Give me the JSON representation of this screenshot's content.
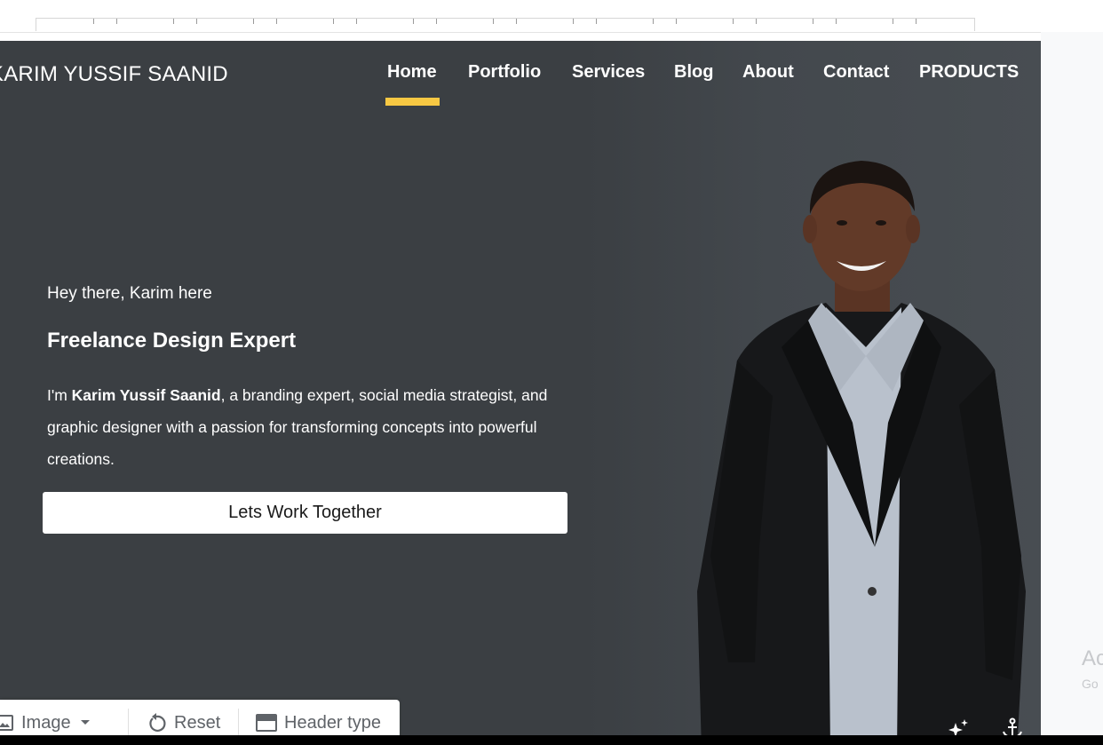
{
  "brand": {
    "name": "KARIM YUSSIF SAANID"
  },
  "nav": {
    "items": [
      {
        "label": "Home",
        "active": true
      },
      {
        "label": "Portfolio"
      },
      {
        "label": "Services"
      },
      {
        "label": "Blog"
      },
      {
        "label": "About"
      },
      {
        "label": "Contact"
      },
      {
        "label": "PRODUCTS"
      }
    ]
  },
  "hero": {
    "greeting": "Hey there, Karim here",
    "headline": "Freelance Design Expert",
    "bio_prefix": "I'm ",
    "bio_name": "Karim Yussif Saanid",
    "bio_rest": ", a branding expert, social media strategist, and graphic designer with a passion for transforming concepts into powerful creations.",
    "cta_label": "Lets Work Together"
  },
  "toolbar": {
    "image_label": "Image",
    "reset_label": "Reset",
    "header_type_label": "Header type"
  },
  "side_panel": {
    "text_large": "Ac",
    "text_small": "Go"
  },
  "icons": {
    "image": "image-icon",
    "dropdown": "chevron-down-icon",
    "reset": "reset-icon",
    "header_type": "header-type-icon",
    "sparkle": "sparkle-icon",
    "anchor": "anchor-icon"
  },
  "colors": {
    "hero_bg": "#3b3f43",
    "accent": "#f7c843",
    "text": "#ffffff",
    "toolbar_text": "#5f6368"
  }
}
